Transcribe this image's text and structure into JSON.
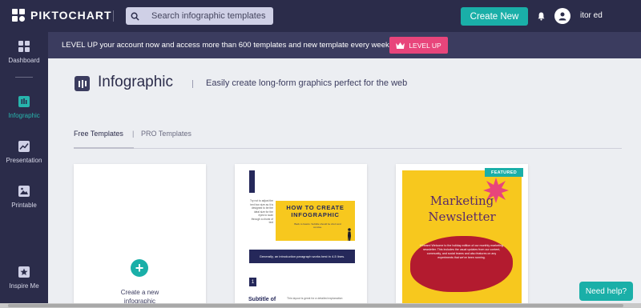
{
  "topbar": {
    "brand": "PIKTOCHART",
    "search_placeholder": "Search infographic templates",
    "create_label": "Create New",
    "username": "itor ed"
  },
  "sidebar": {
    "items": [
      {
        "label": "Dashboard",
        "icon": "dashboard-icon"
      },
      {
        "label": "Infographic",
        "icon": "infographic-icon",
        "active": true
      },
      {
        "label": "Presentation",
        "icon": "presentation-icon"
      },
      {
        "label": "Printable",
        "icon": "printable-icon"
      },
      {
        "label": "Inspire Me",
        "icon": "star-icon"
      }
    ]
  },
  "banner": {
    "text": "LEVEL UP your account now and access more than 600 templates and new template every week.",
    "button_label": "LEVEL UP"
  },
  "header": {
    "title": "Infographic",
    "subtitle": "Easily create long-form graphics perfect for the web"
  },
  "tabs": {
    "free": "Free Templates",
    "pro": "PRO Templates"
  },
  "cards": {
    "new_line1": "Create a new",
    "new_line2": "infographic",
    "info_title": "HOW TO CREATE INFOGRAPHIC",
    "info_left_copy": "Try not to adjust the text box size as it is designed to be the ideal size for the eyes to scan through a chunk of text",
    "info_tagline": "Back to basics. Subtitle should be short and concise.",
    "info_band": "Generally, an introduction paragraph works best in 4-5 lines.",
    "info_number": "1",
    "info_subtitle": "Subtitle of",
    "info_body": "This layout is great for a detailed explanation",
    "news_title_1": "Marketing",
    "news_title_2": "Newsletter",
    "news_copy": "Hi team! Welcome to the holiday edition of our monthly marketing newsletter. This includes the usual updates from our content, community, and social teams and also features on any experiments that we've been running.",
    "featured": "FEATURED"
  },
  "help": {
    "label": "Need help?"
  },
  "colors": {
    "navy": "#2b2c4a",
    "teal": "#1aafa8",
    "pink": "#e8457b",
    "yellow": "#f7c81e"
  }
}
